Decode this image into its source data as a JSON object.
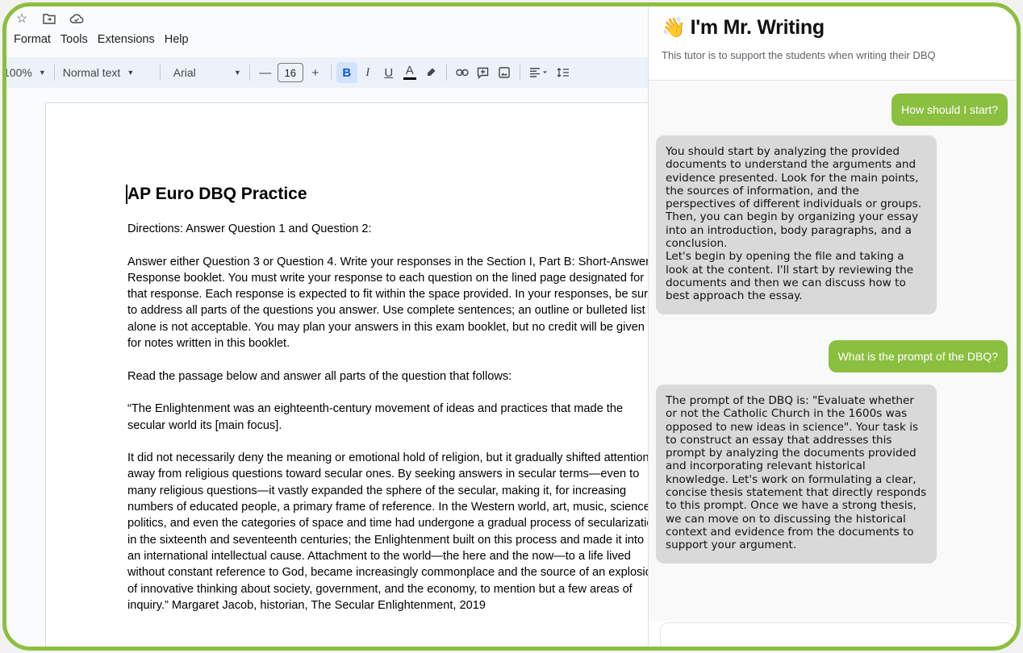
{
  "docs": {
    "menu": [
      "Format",
      "Tools",
      "Extensions",
      "Help"
    ],
    "icons": [
      "star-icon",
      "move-to-folder-icon",
      "cloud-status-icon"
    ],
    "toolbar": {
      "zoom": "100%",
      "style": "Normal text",
      "font": "Arial",
      "font_size": "16",
      "minus": "—",
      "plus": "+",
      "bold": "B",
      "italic": "I",
      "underline": "U",
      "text_color": "A"
    },
    "document": {
      "title": "AP Euro DBQ Practice",
      "paragraphs": [
        "Directions: Answer Question 1 and Question 2:",
        "Answer either Question 3 or Question 4. Write your responses in the Section I, Part B: Short-Answer Response booklet. You must write your response to each question on the lined page designated for that response. Each response is expected to fit within the space provided. In your responses, be sure to address all parts of the questions you answer. Use complete sentences; an outline or bulleted list alone is not acceptable. You may plan your answers in this exam booklet, but no credit will be given for notes written in this booklet.",
        "Read the passage below and answer all parts of the question that follows:",
        "“The Enlightenment was an eighteenth-century movement of ideas and practices that made the secular world its [main focus].",
        "It did not necessarily deny the meaning or emotional hold of religion, but it gradually shifted attention away from religious questions toward secular ones. By seeking answers in secular terms—even to many religious questions—it vastly expanded the sphere of the secular, making it, for increasing numbers of educated people, a primary frame of reference. In the Western world, art, music, science, politics, and even the categories of space and time had undergone a gradual process of secularization in the sixteenth and seventeenth centuries; the Enlightenment built on this process and made it into an international intellectual cause. Attachment to the world—the here and the now—to a life lived without constant reference to God, became increasingly commonplace and the source of an explosion of innovative thinking about society, government, and the economy, to mention but a few areas of inquiry.” Margaret Jacob, historian, The Secular Enlightenment, 2019"
      ]
    }
  },
  "chat": {
    "title": "I'm Mr. Writing",
    "wave_emoji": "👋",
    "subtitle": "This tutor is to support the students when writing their DBQ",
    "messages": [
      {
        "role": "user",
        "text": "How should I start?"
      },
      {
        "role": "bot",
        "text": "You should start by analyzing the provided documents to understand the arguments and evidence presented. Look for the main points, the sources of information, and the perspectives of different individuals or groups. Then, you can begin by organizing your essay into an introduction, body paragraphs, and a conclusion.\nLet's begin by opening the file and taking a look at the content. I'll start by reviewing the documents and then we can discuss how to best approach the essay."
      },
      {
        "role": "user",
        "text": "What is the prompt of the DBQ?"
      },
      {
        "role": "bot",
        "text": "The prompt of the DBQ is: \"Evaluate whether or not the Catholic Church in the 1600s was opposed to new ideas in science\". Your task is to construct an essay that addresses this prompt by analyzing the documents provided and incorporating relevant historical knowledge. Let's work on formulating a clear, concise thesis statement that directly responds to this prompt. Once we have a strong thesis, we can move on to discussing the historical context and evidence from the documents to support your argument."
      }
    ]
  },
  "colors": {
    "accent_green": "#8bbf3f",
    "bot_bubble": "#d9d9d9",
    "toolbar_bg": "#edf2fa",
    "bold_active": "#d3e3fd"
  }
}
